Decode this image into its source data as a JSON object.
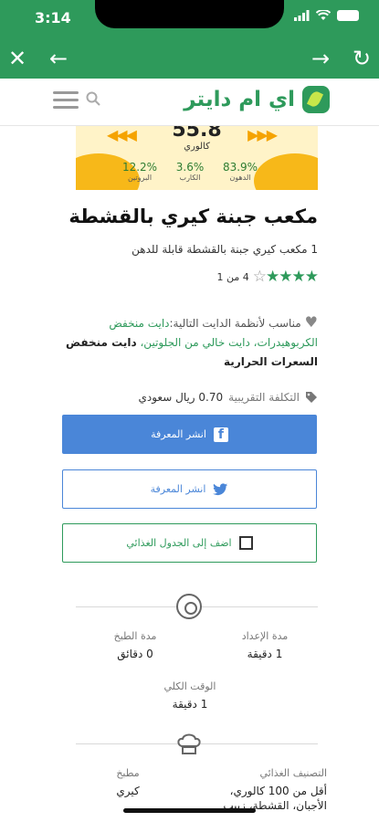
{
  "status_bar": {
    "time": "3:14"
  },
  "browser": {
    "close_icon": "close-icon",
    "back_icon": "back-arrow-icon",
    "forward_icon": "forward-arrow-icon",
    "refresh_icon": "refresh-icon"
  },
  "header": {
    "logo_text": "اي ام دايتر",
    "menu_icon": "hamburger-icon",
    "search_icon": "search-icon"
  },
  "hero": {
    "calories_value": "55.8",
    "calories_label": "كالوري",
    "macros": [
      {
        "value": "12.2%",
        "label": "البروتين"
      },
      {
        "value": "3.6%",
        "label": "الكارب"
      },
      {
        "value": "83.9%",
        "label": "الدهون"
      }
    ]
  },
  "recipe": {
    "title": "مكعب جبنة كيري بالقشطة",
    "serving": "1 مكعب كيري جبنة بالقشطة قابلة للدهن",
    "rating_text": "4 من 1",
    "rating_value": 4,
    "rating_max": 5,
    "diet_label": "مناسب لأنظمة الدايت التالية:",
    "diet_green": "دايت منخفض الكربوهيدرات، دايت خالي من الجلوتين،",
    "diet_bold": "دايت منخفض السعرات الحرارية",
    "cost_label": "التكلفة التقريبية",
    "cost_value": "0.70 ريال سعودي"
  },
  "buttons": {
    "facebook": "انشر المعرفة",
    "twitter": "انشر المعرفة",
    "add_meal_plan": "اضف إلى الجدول الغذائي"
  },
  "times": {
    "prep_label": "مدة الإعداد",
    "prep_value": "1 دقيقة",
    "cook_label": "مدة الطبخ",
    "cook_value": "0 دقائق",
    "total_label": "الوقت الكلي",
    "total_value": "1 دقيقة"
  },
  "classification": {
    "label": "التصنيف الغذائي",
    "value_line1": "أقل من 100 كالوري،",
    "value_line2": "الأجبان، القشطة، زبيب",
    "cuisine_label": "مطبخ",
    "cuisine_value": "كيري"
  },
  "colors": {
    "brand_green": "#2e9a5b",
    "facebook_blue": "#4a86d8",
    "hero_yellow": "#f7b819"
  }
}
